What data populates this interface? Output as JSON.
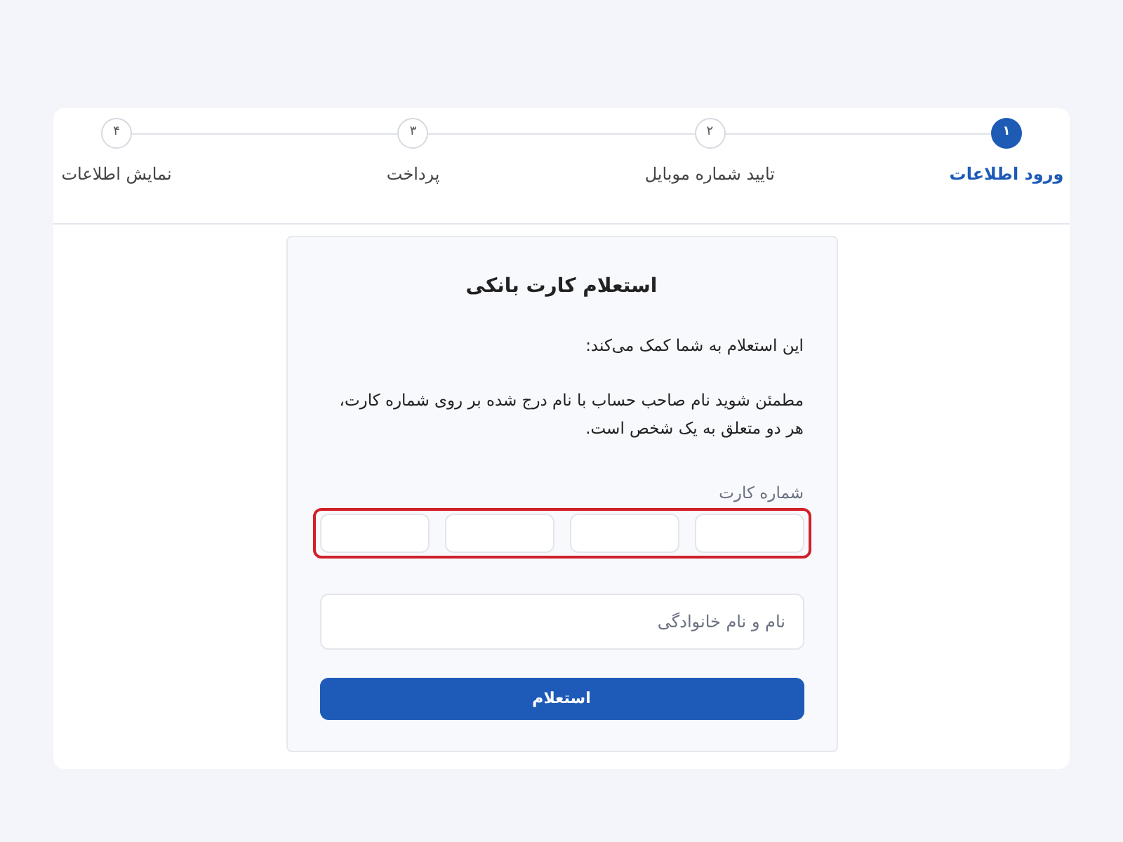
{
  "steps": [
    {
      "number": "۱",
      "label": "ورود اطلاعات",
      "selected": true
    },
    {
      "number": "۲",
      "label": "تایید شماره موبایل",
      "selected": false
    },
    {
      "number": "۳",
      "label": "پرداخت",
      "selected": false
    },
    {
      "number": "۴",
      "label": "نمایش اطلاعات",
      "selected": false
    }
  ],
  "form": {
    "title": "استعلام کارت بانکی",
    "intro": "این استعلام به شما کمک می‌کند:",
    "description": "مطمئن شوید نام صاحب حساب با نام درج شده بر روی شماره کارت، هر دو متعلق به یک شخص است.",
    "card_number": {
      "label": "شماره کارت",
      "highlighted": true
    },
    "name_field": {
      "placeholder": "نام و نام خانوادگی"
    },
    "submit_button": "استعلام"
  }
}
